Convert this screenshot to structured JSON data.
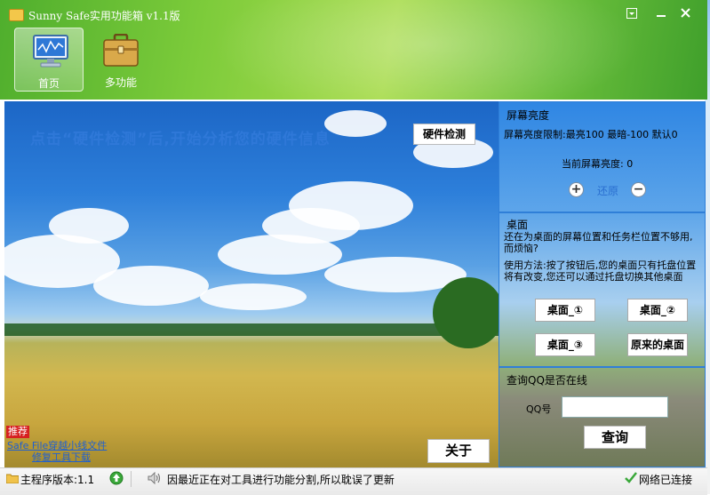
{
  "window": {
    "title": "Sunny Safe实用功能箱 v1.1版",
    "controls": [
      "minimize-to-tray",
      "minimize",
      "close"
    ]
  },
  "nav": {
    "home_label": "首页",
    "multi_label": "多功能",
    "active": "home"
  },
  "main": {
    "headline": "点击“硬件检测”后,开始分析您的硬件信息",
    "detect_button": "硬件检测",
    "recommend_tag": "推荐",
    "link1": "Safe File穿越小线文件",
    "link2": "修复工具下载",
    "about_button": "关于"
  },
  "brightness": {
    "title": "屏幕亮度",
    "limits": "屏幕亮度限制:最亮100 最暗-100 默认0",
    "current": "当前屏幕亮度: 0",
    "increase_symbol": "+",
    "restore_label": "还原",
    "decrease_symbol": "−"
  },
  "desktop": {
    "title": "桌面",
    "question": "还在为桌面的屏幕位置和任务栏位置不够用,而烦恼?",
    "usage": "使用方法:按了按钮后,您的桌面只有托盘位置将有改变,您还可以通过托盘切换其他桌面",
    "btn1": "桌面_①",
    "btn2": "桌面_②",
    "btn3": "桌面_③",
    "btn_original": "原来的桌面"
  },
  "qq": {
    "title": "查询QQ是否在线",
    "label": "QQ号",
    "input_value": "",
    "query_button": "查询"
  },
  "status": {
    "version": "主程序版本:1.1",
    "notice": "因最近正在对工具进行功能分割,所以耽误了更新",
    "network": "网络已连接"
  },
  "colors": {
    "header_green": "#6cc03c",
    "headline_blue": "#2f78d8",
    "panel_border": "#2f7fd8",
    "recommend_red": "#d62020",
    "link_blue": "#2060d0"
  }
}
